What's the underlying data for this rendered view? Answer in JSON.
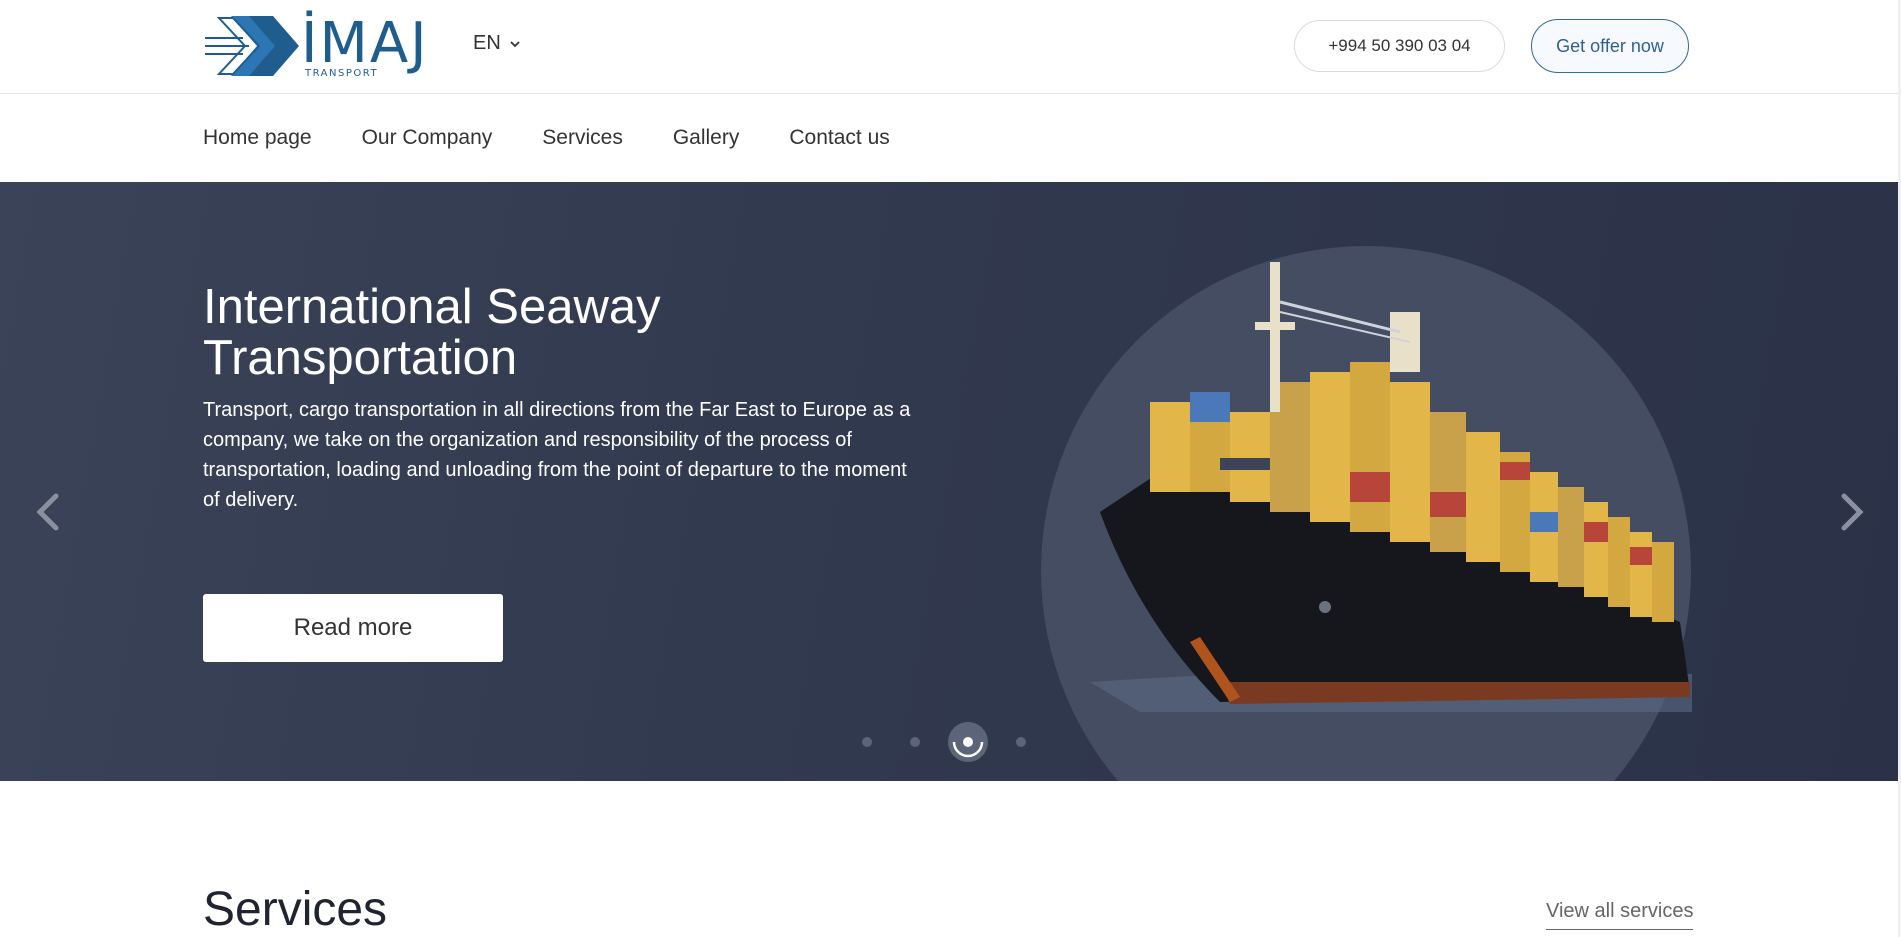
{
  "header": {
    "logo": {
      "word": "İMAJ",
      "sub": "TRANSPORT"
    },
    "language": "EN",
    "phone": "+994 50 390 03 04",
    "offer_label": "Get offer now"
  },
  "nav": {
    "items": [
      {
        "label": "Home page"
      },
      {
        "label": "Our Company"
      },
      {
        "label": "Services"
      },
      {
        "label": "Gallery"
      },
      {
        "label": "Contact us"
      }
    ]
  },
  "hero": {
    "title": "International Seaway Transportation",
    "text": "Transport, cargo transportation in all directions from the Far East to Europe as a company, we take on the organization and responsibility of the process of transportation, loading and unloading from the point of departure to the moment of delivery.",
    "button_label": "Read more",
    "slides_count": 4,
    "active_slide": 3,
    "image": "container-ship",
    "colors": {
      "background": "#323a50",
      "circle": "#454d62"
    }
  },
  "services": {
    "title": "Services",
    "view_all_label": "View all services"
  },
  "colors": {
    "brand": "#1f5d8e",
    "accent": "#2f6aa3"
  },
  "icons": {
    "language_dropdown": "chevron-down-icon",
    "prev": "chevron-left-icon",
    "next": "chevron-right-icon"
  }
}
